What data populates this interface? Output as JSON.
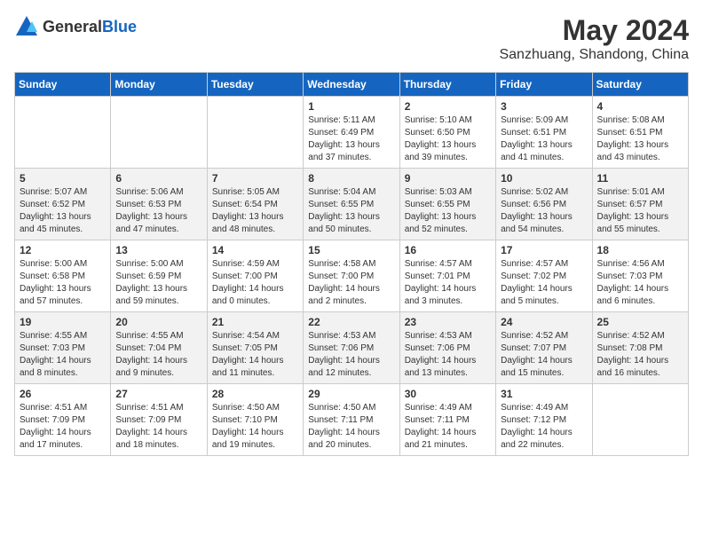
{
  "logo": {
    "general": "General",
    "blue": "Blue"
  },
  "header": {
    "month": "May 2024",
    "location": "Sanzhuang, Shandong, China"
  },
  "days_of_week": [
    "Sunday",
    "Monday",
    "Tuesday",
    "Wednesday",
    "Thursday",
    "Friday",
    "Saturday"
  ],
  "weeks": [
    {
      "days": [
        {
          "number": "",
          "info": ""
        },
        {
          "number": "",
          "info": ""
        },
        {
          "number": "",
          "info": ""
        },
        {
          "number": "1",
          "info": "Sunrise: 5:11 AM\nSunset: 6:49 PM\nDaylight: 13 hours and 37 minutes."
        },
        {
          "number": "2",
          "info": "Sunrise: 5:10 AM\nSunset: 6:50 PM\nDaylight: 13 hours and 39 minutes."
        },
        {
          "number": "3",
          "info": "Sunrise: 5:09 AM\nSunset: 6:51 PM\nDaylight: 13 hours and 41 minutes."
        },
        {
          "number": "4",
          "info": "Sunrise: 5:08 AM\nSunset: 6:51 PM\nDaylight: 13 hours and 43 minutes."
        }
      ]
    },
    {
      "days": [
        {
          "number": "5",
          "info": "Sunrise: 5:07 AM\nSunset: 6:52 PM\nDaylight: 13 hours and 45 minutes."
        },
        {
          "number": "6",
          "info": "Sunrise: 5:06 AM\nSunset: 6:53 PM\nDaylight: 13 hours and 47 minutes."
        },
        {
          "number": "7",
          "info": "Sunrise: 5:05 AM\nSunset: 6:54 PM\nDaylight: 13 hours and 48 minutes."
        },
        {
          "number": "8",
          "info": "Sunrise: 5:04 AM\nSunset: 6:55 PM\nDaylight: 13 hours and 50 minutes."
        },
        {
          "number": "9",
          "info": "Sunrise: 5:03 AM\nSunset: 6:55 PM\nDaylight: 13 hours and 52 minutes."
        },
        {
          "number": "10",
          "info": "Sunrise: 5:02 AM\nSunset: 6:56 PM\nDaylight: 13 hours and 54 minutes."
        },
        {
          "number": "11",
          "info": "Sunrise: 5:01 AM\nSunset: 6:57 PM\nDaylight: 13 hours and 55 minutes."
        }
      ]
    },
    {
      "days": [
        {
          "number": "12",
          "info": "Sunrise: 5:00 AM\nSunset: 6:58 PM\nDaylight: 13 hours and 57 minutes."
        },
        {
          "number": "13",
          "info": "Sunrise: 5:00 AM\nSunset: 6:59 PM\nDaylight: 13 hours and 59 minutes."
        },
        {
          "number": "14",
          "info": "Sunrise: 4:59 AM\nSunset: 7:00 PM\nDaylight: 14 hours and 0 minutes."
        },
        {
          "number": "15",
          "info": "Sunrise: 4:58 AM\nSunset: 7:00 PM\nDaylight: 14 hours and 2 minutes."
        },
        {
          "number": "16",
          "info": "Sunrise: 4:57 AM\nSunset: 7:01 PM\nDaylight: 14 hours and 3 minutes."
        },
        {
          "number": "17",
          "info": "Sunrise: 4:57 AM\nSunset: 7:02 PM\nDaylight: 14 hours and 5 minutes."
        },
        {
          "number": "18",
          "info": "Sunrise: 4:56 AM\nSunset: 7:03 PM\nDaylight: 14 hours and 6 minutes."
        }
      ]
    },
    {
      "days": [
        {
          "number": "19",
          "info": "Sunrise: 4:55 AM\nSunset: 7:03 PM\nDaylight: 14 hours and 8 minutes."
        },
        {
          "number": "20",
          "info": "Sunrise: 4:55 AM\nSunset: 7:04 PM\nDaylight: 14 hours and 9 minutes."
        },
        {
          "number": "21",
          "info": "Sunrise: 4:54 AM\nSunset: 7:05 PM\nDaylight: 14 hours and 11 minutes."
        },
        {
          "number": "22",
          "info": "Sunrise: 4:53 AM\nSunset: 7:06 PM\nDaylight: 14 hours and 12 minutes."
        },
        {
          "number": "23",
          "info": "Sunrise: 4:53 AM\nSunset: 7:06 PM\nDaylight: 14 hours and 13 minutes."
        },
        {
          "number": "24",
          "info": "Sunrise: 4:52 AM\nSunset: 7:07 PM\nDaylight: 14 hours and 15 minutes."
        },
        {
          "number": "25",
          "info": "Sunrise: 4:52 AM\nSunset: 7:08 PM\nDaylight: 14 hours and 16 minutes."
        }
      ]
    },
    {
      "days": [
        {
          "number": "26",
          "info": "Sunrise: 4:51 AM\nSunset: 7:09 PM\nDaylight: 14 hours and 17 minutes."
        },
        {
          "number": "27",
          "info": "Sunrise: 4:51 AM\nSunset: 7:09 PM\nDaylight: 14 hours and 18 minutes."
        },
        {
          "number": "28",
          "info": "Sunrise: 4:50 AM\nSunset: 7:10 PM\nDaylight: 14 hours and 19 minutes."
        },
        {
          "number": "29",
          "info": "Sunrise: 4:50 AM\nSunset: 7:11 PM\nDaylight: 14 hours and 20 minutes."
        },
        {
          "number": "30",
          "info": "Sunrise: 4:49 AM\nSunset: 7:11 PM\nDaylight: 14 hours and 21 minutes."
        },
        {
          "number": "31",
          "info": "Sunrise: 4:49 AM\nSunset: 7:12 PM\nDaylight: 14 hours and 22 minutes."
        },
        {
          "number": "",
          "info": ""
        }
      ]
    }
  ]
}
